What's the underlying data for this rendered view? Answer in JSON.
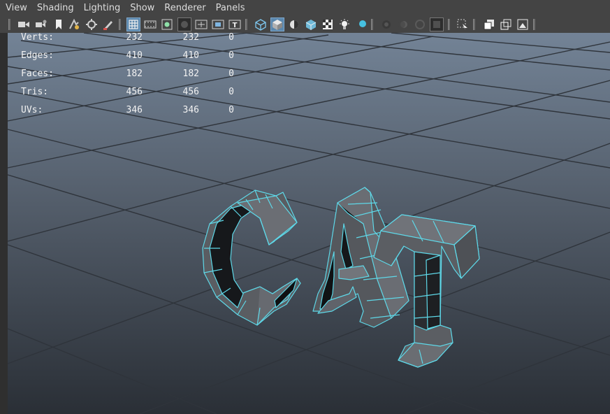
{
  "menu": {
    "items": [
      "View",
      "Shading",
      "Lighting",
      "Show",
      "Renderer",
      "Panels"
    ]
  },
  "toolbar": {
    "icons": [
      "camera-select-icon",
      "camera-attributes-icon",
      "bookmark-icon",
      "image-plane-icon",
      "2d-pan-zoom-icon",
      "grease-pencil-icon",
      "grid-icon",
      "film-gate-icon",
      "resolution-gate-icon",
      "gate-mask-icon",
      "field-chart-icon",
      "safe-action-icon",
      "safe-title-icon",
      "wireframe-icon",
      "smooth-shade-icon",
      "use-default-material-icon",
      "wireframe-on-shaded-icon",
      "textured-icon",
      "use-all-lights-icon",
      "shadows-icon",
      "screen-space-ambient-occlusion-icon",
      "motion-blur-icon",
      "multisample-aa-icon",
      "depth-of-field-icon",
      "isolate-select-icon",
      "xray-icon",
      "xray-joints-icon",
      "xray-active-components-icon",
      "exposure-icon"
    ]
  },
  "hud": {
    "rows": [
      {
        "label": "Verts:",
        "v1": "232",
        "v2": "232",
        "v3": "0"
      },
      {
        "label": "Edges:",
        "v1": "410",
        "v2": "410",
        "v3": "0"
      },
      {
        "label": "Faces:",
        "v1": "182",
        "v2": "182",
        "v3": "0"
      },
      {
        "label": "Tris:",
        "v1": "456",
        "v2": "456",
        "v3": "0"
      },
      {
        "label": "UVs:",
        "v1": "346",
        "v2": "346",
        "v3": "0"
      }
    ]
  },
  "colors": {
    "viewport_top": "#6f7f92",
    "viewport_bottom": "#2a2f36",
    "grid_line": "#2e3238",
    "selection_wire": "#5ed8e8",
    "mesh_face": "#5a5d62",
    "mesh_dark": "#16181b",
    "active_button": "#5a87ad"
  },
  "viewport": {
    "model_text": "CAT"
  }
}
